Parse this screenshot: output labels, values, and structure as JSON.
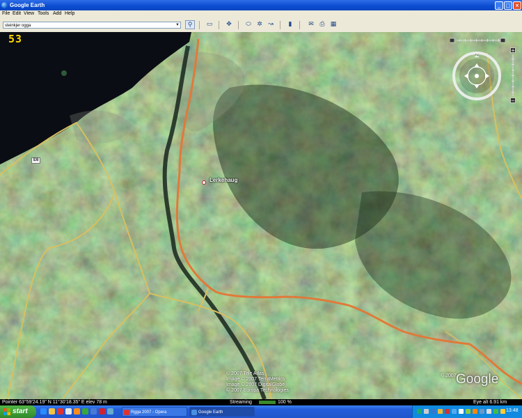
{
  "window": {
    "title": "Google Earth",
    "btn_min": "_",
    "btn_max": "□",
    "btn_close": "×"
  },
  "menu": {
    "file": "File",
    "edit": "Edit",
    "view": "View",
    "tools": "Tools",
    "add": "Add",
    "help": "Help"
  },
  "search": {
    "value": "steinkjer ogga"
  },
  "map": {
    "fps": "53",
    "placemark_label": "Lerkehaug",
    "road_tag": "E6",
    "copyright_lines": [
      "© 2007 Tele Atlas",
      "Image © 2007 TerraMetrics",
      "Image © 2007 DigitalGlobe",
      "© 2007 Europa Technologies"
    ],
    "logo_text": "Google",
    "logo_copyright": "© 2007"
  },
  "status": {
    "pointer": "Pointer 63°59'24.19\" N 11°30'18.35\" E elev 78 m",
    "streaming_label": "Streaming",
    "streaming_percent": "100 %",
    "streaming_fraction": 1.0,
    "eye_alt": "Eye alt 6.91 km"
  },
  "taskbar": {
    "start_label": "start",
    "tasks": [
      {
        "label": "Rgga 2007 - Opera"
      },
      {
        "label": "Google Earth"
      }
    ],
    "clock": "13:48"
  },
  "colors": {
    "title_blue": "#0a4bd0",
    "fps_yellow": "#ffd800",
    "road_orange": "#e07a3a",
    "road_yellow": "#d8c060",
    "water": "#0b0d14"
  }
}
